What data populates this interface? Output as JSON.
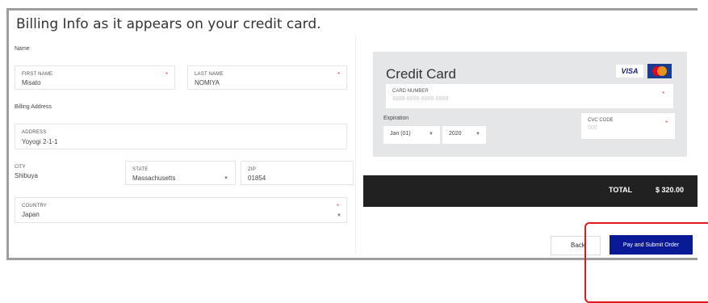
{
  "heading": "Billing Info as it appears on your credit card.",
  "name_section": {
    "label": "Name",
    "first_name": {
      "label": "FIRST NAME",
      "value": "Misato",
      "required": "*"
    },
    "last_name": {
      "label": "LAST NAME",
      "value": "NOMIYA",
      "required": "*"
    }
  },
  "address_section": {
    "label": "Billing Address",
    "address": {
      "label": "ADDRESS",
      "value": "Yoyogi 2-1-1"
    },
    "city": {
      "label": "CITY",
      "value": "Shibuya"
    },
    "state": {
      "label": "STATE",
      "value": "Massachusetts"
    },
    "zip": {
      "label": "ZIP",
      "value": "01854"
    },
    "country": {
      "label": "COUNTRY",
      "value": "Japan",
      "required": "*"
    }
  },
  "credit_card": {
    "title": "Credit Card",
    "brands": [
      "VISA",
      "mastercard"
    ],
    "card_number": {
      "label": "CARD NUMBER",
      "placeholder": "8888-8888-8888-8888",
      "required": "*"
    },
    "expiration_label": "Expiration",
    "month": "Jan (01)",
    "year": "2020",
    "cvc": {
      "label": "CVC CODE",
      "placeholder": "000",
      "required": "*"
    }
  },
  "total": {
    "label": "TOTAL",
    "amount": "$ 320.00"
  },
  "buttons": {
    "back": "Back",
    "submit": "Pay and Submit Order"
  },
  "colors": {
    "submit_bg": "#0a1a96",
    "total_bg": "#212121",
    "highlight": "#e0191f",
    "card_panel": "#e4e6e8"
  }
}
